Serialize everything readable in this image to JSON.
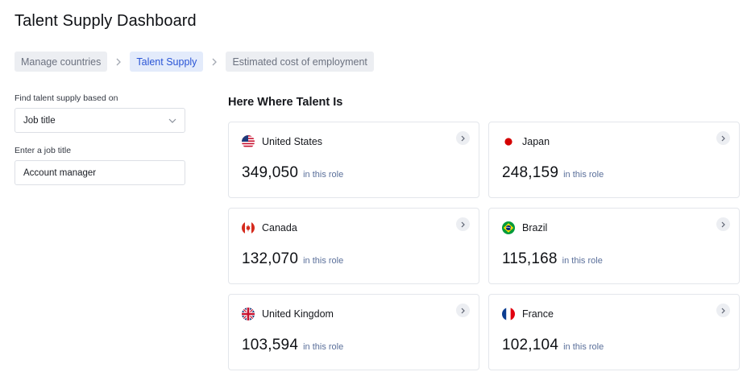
{
  "page": {
    "title": "Talent Supply Dashboard"
  },
  "breadcrumbs": [
    {
      "label": "Manage countries",
      "active": false
    },
    {
      "label": "Talent Supply",
      "active": true
    },
    {
      "label": "Estimated cost of employment",
      "active": false
    }
  ],
  "filters": {
    "basis_label": "Find talent supply based on",
    "basis_value": "Job title",
    "job_label": "Enter a job title",
    "job_value": "Account manager"
  },
  "results": {
    "title": "Here Where Talent Is",
    "suffix": "in this role",
    "cards": [
      {
        "country": "United States",
        "count": "349,050",
        "flag_icon": "us-flag-icon"
      },
      {
        "country": "Japan",
        "count": "248,159",
        "flag_icon": "japan-flag-icon"
      },
      {
        "country": "Canada",
        "count": "132,070",
        "flag_icon": "canada-flag-icon"
      },
      {
        "country": "Brazil",
        "count": "115,168",
        "flag_icon": "brazil-flag-icon"
      },
      {
        "country": "United Kingdom",
        "count": "103,594",
        "flag_icon": "uk-flag-icon"
      },
      {
        "country": "France",
        "count": "102,104",
        "flag_icon": "france-flag-icon"
      }
    ]
  },
  "colors": {
    "accent": "#2a55d6",
    "accent_bg": "#e3ebfb",
    "muted_bg": "#eceef2",
    "suffix_text": "#5a6f9a"
  }
}
